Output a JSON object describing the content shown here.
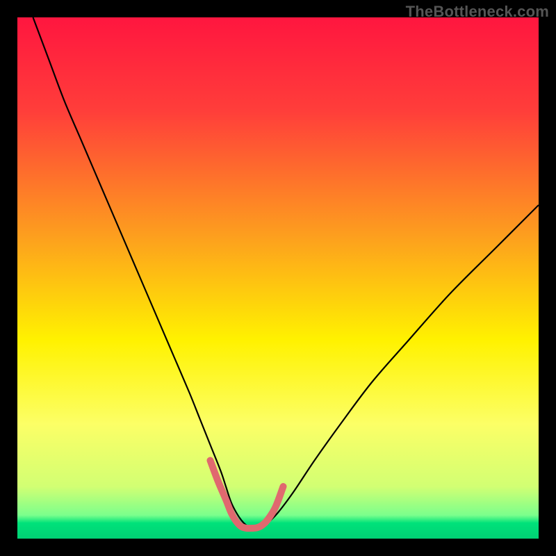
{
  "watermark": "TheBottleneck.com",
  "chart_data": {
    "type": "line",
    "title": "",
    "xlabel": "",
    "ylabel": "",
    "xlim": [
      0,
      100
    ],
    "ylim": [
      0,
      100
    ],
    "background_gradient": {
      "stops": [
        {
          "offset": 0.0,
          "color": "#ff163f"
        },
        {
          "offset": 0.18,
          "color": "#ff3e3a"
        },
        {
          "offset": 0.42,
          "color": "#fd9f1e"
        },
        {
          "offset": 0.62,
          "color": "#fff200"
        },
        {
          "offset": 0.78,
          "color": "#fcff66"
        },
        {
          "offset": 0.9,
          "color": "#d2ff73"
        },
        {
          "offset": 0.955,
          "color": "#7bff8c"
        },
        {
          "offset": 0.97,
          "color": "#00e27a"
        },
        {
          "offset": 1.0,
          "color": "#00d074"
        }
      ]
    },
    "series": [
      {
        "name": "bottleneck-curve",
        "stroke": "#000000",
        "stroke_width": 2.2,
        "x": [
          3,
          6,
          9,
          12,
          15,
          18,
          21,
          24,
          27,
          30,
          33,
          35,
          37,
          39,
          40,
          41,
          42,
          43,
          44,
          45,
          46,
          47,
          48,
          50,
          53,
          57,
          62,
          68,
          75,
          83,
          92,
          100
        ],
        "y": [
          100,
          92,
          84,
          77,
          70,
          63,
          56,
          49,
          42,
          35,
          28,
          23,
          18,
          13,
          10,
          7,
          5,
          3.5,
          2.5,
          2,
          2,
          2.5,
          3,
          5,
          9,
          15,
          22,
          30,
          38,
          47,
          56,
          64
        ]
      },
      {
        "name": "optimal-range-marker",
        "stroke": "#e0696f",
        "stroke_width": 10,
        "linecap": "round",
        "x": [
          37,
          38.5,
          40,
          41,
          42,
          43,
          44,
          45,
          46,
          47,
          48,
          49.5,
          51
        ],
        "y": [
          15,
          11,
          7.5,
          5,
          3.3,
          2.3,
          2,
          2,
          2.1,
          2.6,
          3.6,
          6,
          10
        ]
      }
    ]
  }
}
